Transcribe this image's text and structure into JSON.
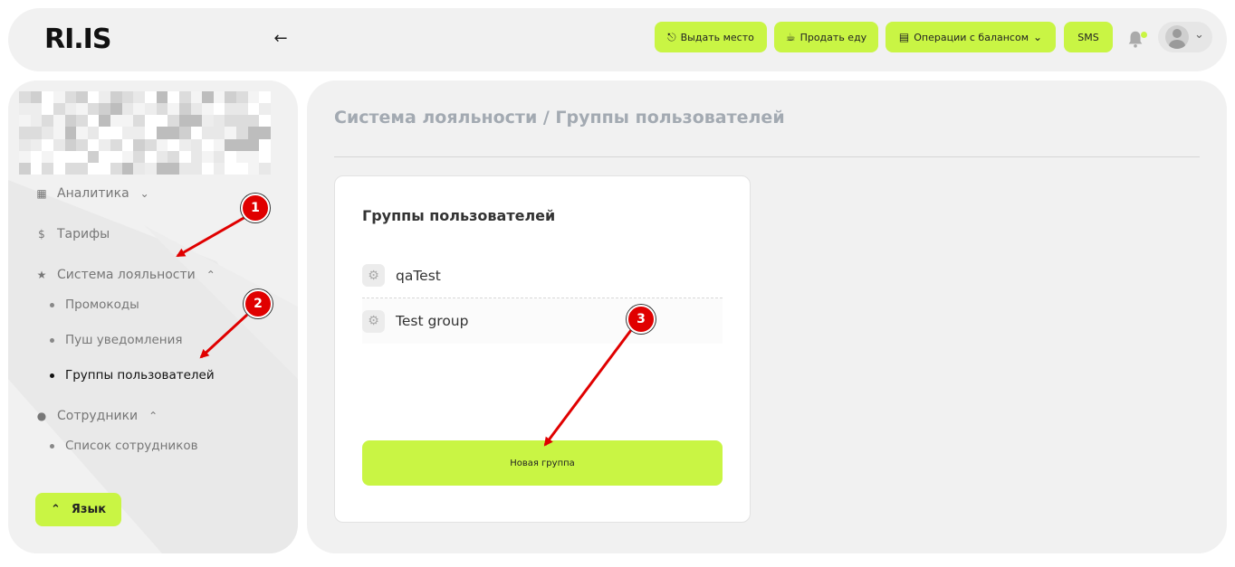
{
  "header": {
    "logo": "RI.IS",
    "buttons": {
      "give_place": "Выдать место",
      "sell_food": "Продать еду",
      "balance_ops": "Операции с балансом",
      "sms": "SMS"
    }
  },
  "sidebar": {
    "items": [
      {
        "label": "Аналитика",
        "icon": "dashboard-icon"
      },
      {
        "label": "Тарифы",
        "icon": "dollar-icon"
      },
      {
        "label": "Система лояльности",
        "icon": "star-icon"
      },
      {
        "label": "Сотрудники",
        "icon": "person-icon"
      }
    ],
    "loyalty_sub": [
      "Промокоды",
      "Пуш уведомления",
      "Группы пользователей"
    ],
    "staff_sub": [
      "Список сотрудников"
    ],
    "language_button": "Язык"
  },
  "main": {
    "page_title": "Система лояльности / Группы пользователей",
    "card": {
      "title": "Группы пользователей",
      "groups": [
        "qaTest",
        "Test group"
      ],
      "new_group_button": "Новая группа"
    }
  },
  "annotations": {
    "badges": [
      "1",
      "2",
      "3"
    ],
    "color": "#e00000"
  },
  "colors": {
    "accent": "#c9f544",
    "panel": "#f1f1f1",
    "title_gray": "#a3aab2"
  }
}
